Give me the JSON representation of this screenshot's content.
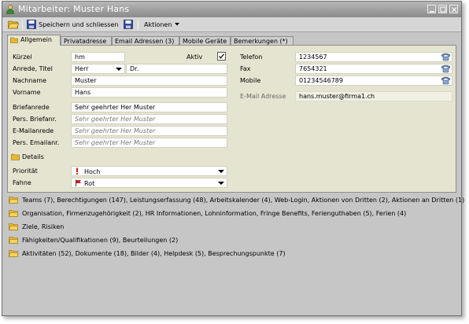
{
  "window": {
    "title": "Mitarbeiter: Muster Hans"
  },
  "toolbar": {
    "save_close_label": "Speichern und schliessen",
    "actions_label": "Aktionen"
  },
  "tabs": [
    {
      "label": "Allgemein",
      "active": true
    },
    {
      "label": "Privatadresse",
      "active": false
    },
    {
      "label": "Email Adressen (3)",
      "active": false
    },
    {
      "label": "Mobile Geräte",
      "active": false
    },
    {
      "label": "Bemerkungen (*)",
      "active": false
    }
  ],
  "form": {
    "kuerzel": {
      "label": "Kürzel",
      "value": "hm"
    },
    "aktiv": {
      "label": "Aktiv",
      "checked": true
    },
    "anrede": {
      "label": "Anrede, Titel",
      "value": "Herr",
      "titel": "Dr."
    },
    "nachname": {
      "label": "Nachname",
      "value": "Muster"
    },
    "vorname": {
      "label": "Vorname",
      "value": "Hans"
    },
    "briefanrede": {
      "label": "Briefanrede",
      "value": "Sehr geehrter Her Muster"
    },
    "pers_briefanr": {
      "label": "Pers. Briefanr.",
      "placeholder": "Sehr geehrter Her Muster"
    },
    "emailanrede": {
      "label": "E-Mailanrede",
      "placeholder": "Sehr geehrter Her Muster"
    },
    "pers_emailanr": {
      "label": "Pers. Emailanr.",
      "placeholder": "Sehr geehrter Her Muster"
    },
    "telefon": {
      "label": "Telefon",
      "value": "1234567"
    },
    "fax": {
      "label": "Fax",
      "value": "7654321"
    },
    "mobile": {
      "label": "Mobile",
      "value": "01234546789"
    },
    "email": {
      "label": "E-Mail Adresse",
      "value": "hans.muster@firma1.ch"
    }
  },
  "details": {
    "title": "Details",
    "prioritaet": {
      "label": "Priorität",
      "value": "Hoch",
      "icon": "exclamation-icon"
    },
    "fahne": {
      "label": "Fahne",
      "value": "Rot",
      "icon": "red-flag-icon"
    }
  },
  "sections": [
    "Teams (7), Berechtigungen (147), Leistungserfassung (48), Arbeitskalender (4), Web-Login, Aktionen von Dritten (2), Aktionen an Dritten (1)",
    "Organisation, Firmenzugehörigkeit (2), HR Informationen, Lohninformation, Fringe Benefits, Ferienguthaben (5), Ferien (4)",
    "Ziele, Risiken",
    "Fähigkeiten/Qualifikationen (9), Beurteilungen (2)",
    "Aktivitäten (52), Dokumente (18), Bilder (4), Helpdesk (5), Besprechungspunkte (7)"
  ],
  "colors": {
    "panel": "#e4e4d0",
    "window": "#c6c6c6",
    "titlebar": "#8a8a8a",
    "folder": "#e8b830"
  }
}
